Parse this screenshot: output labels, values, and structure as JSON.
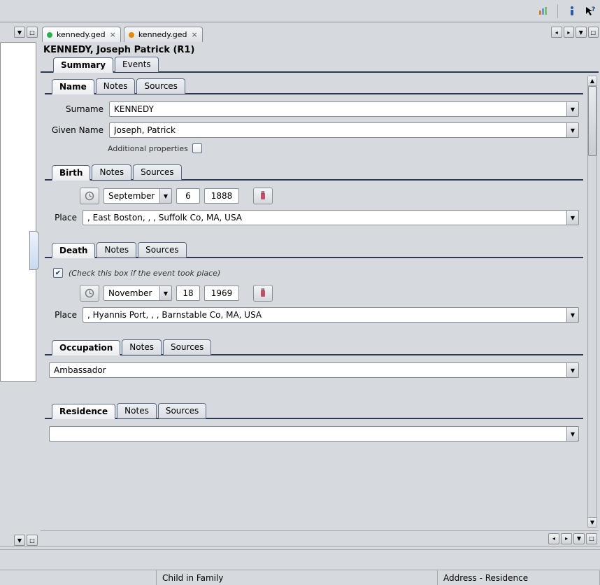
{
  "toolbar": {},
  "doc_tabs": [
    {
      "label": "kennedy.ged",
      "color": "#2bb24c",
      "active": true
    },
    {
      "label": "kennedy.ged",
      "color": "#e38b00",
      "active": false
    }
  ],
  "person_title": "KENNEDY, Joseph Patrick (R1)",
  "main_tabs": {
    "summary": "Summary",
    "events": "Events"
  },
  "sections": {
    "name": {
      "tab_main": "Name",
      "tab_notes": "Notes",
      "tab_sources": "Sources",
      "surname_label": "Surname",
      "surname_value": "KENNEDY",
      "given_label": "Given Name",
      "given_value": "Joseph, Patrick",
      "addl_label": "Additional properties"
    },
    "birth": {
      "tab_main": "Birth",
      "tab_notes": "Notes",
      "tab_sources": "Sources",
      "month": "September",
      "day": "6",
      "year": "1888",
      "place_label": "Place",
      "place_value": ", East Boston, , , Suffolk Co, MA, USA"
    },
    "death": {
      "tab_main": "Death",
      "tab_notes": "Notes",
      "tab_sources": "Sources",
      "check_hint": "(Check this box if the event took place)",
      "checked": true,
      "month": "November",
      "day": "18",
      "year": "1969",
      "place_label": "Place",
      "place_value": ", Hyannis Port, , , Barnstable Co, MA, USA"
    },
    "occupation": {
      "tab_main": "Occupation",
      "tab_notes": "Notes",
      "tab_sources": "Sources",
      "value": "Ambassador"
    },
    "residence": {
      "tab_main": "Residence",
      "tab_notes": "Notes",
      "tab_sources": "Sources",
      "value": ""
    }
  },
  "statusbar": {
    "left": "",
    "mid": "Child in Family",
    "right": "Address - Residence"
  }
}
